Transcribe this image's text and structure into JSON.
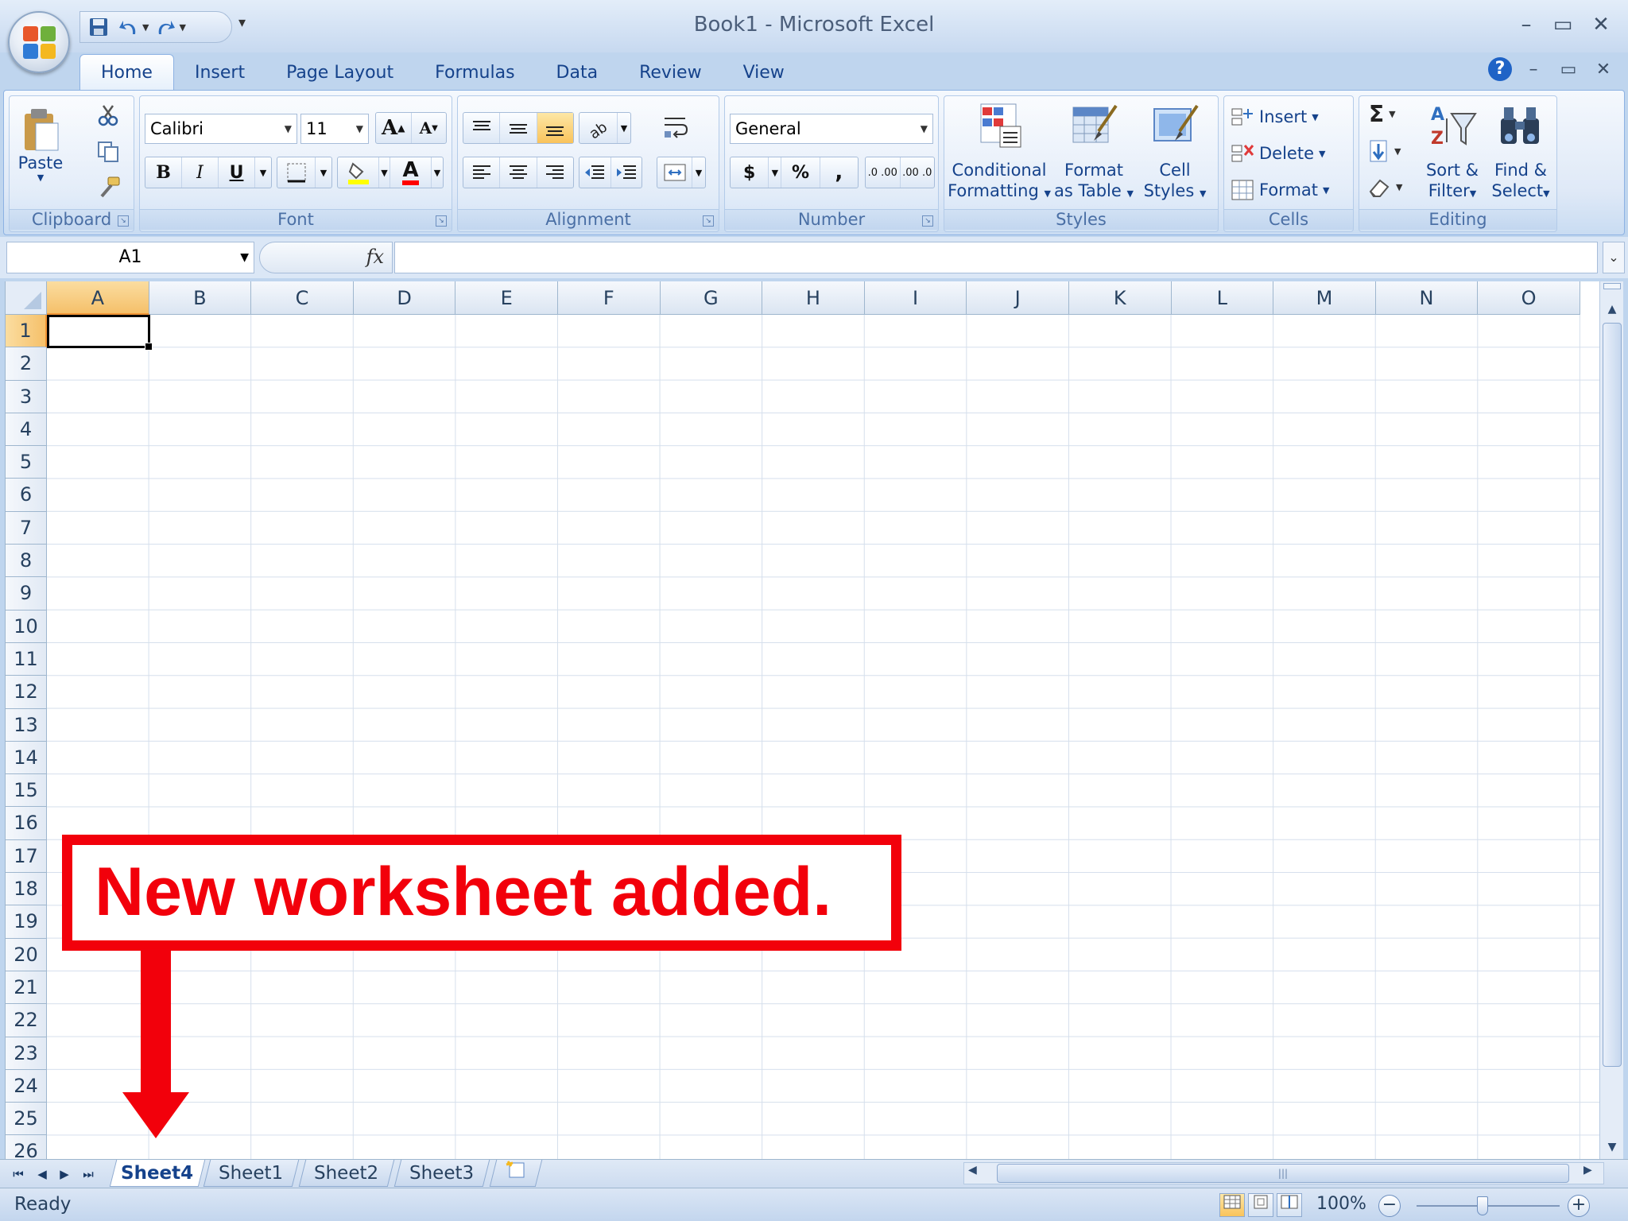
{
  "window": {
    "title": "Book1 - Microsoft Excel",
    "controls": {
      "minimize": "–",
      "restore": "▭",
      "close": "✕"
    }
  },
  "quick_access": {
    "customize": "▾"
  },
  "tabs": [
    "Home",
    "Insert",
    "Page Layout",
    "Formulas",
    "Data",
    "Review",
    "View"
  ],
  "active_tab": "Home",
  "help": "?",
  "ribbon": {
    "clipboard": {
      "label": "Clipboard",
      "paste": "Paste"
    },
    "font": {
      "label": "Font",
      "name": "Calibri",
      "size": "11",
      "bold": "B",
      "italic": "I",
      "underline": "U",
      "grow": "A",
      "shrink": "A",
      "color_letter": "A"
    },
    "alignment": {
      "label": "Alignment"
    },
    "number": {
      "label": "Number",
      "format": "General",
      "currency": "$",
      "percent": "%",
      "comma": ",",
      "inc_decimal": ".0 .00",
      "dec_decimal": ".00 .0"
    },
    "styles": {
      "label": "Styles",
      "conditional": [
        "Conditional",
        "Formatting"
      ],
      "format_table": [
        "Format",
        "as Table"
      ],
      "cell_styles": [
        "Cell",
        "Styles"
      ]
    },
    "cells": {
      "label": "Cells",
      "insert": "Insert",
      "delete": "Delete",
      "format": "Format"
    },
    "editing": {
      "label": "Editing",
      "sigma": "Σ",
      "sort": [
        "Sort &",
        "Filter"
      ],
      "find": [
        "Find &",
        "Select"
      ]
    }
  },
  "formula_bar": {
    "name_box": "A1",
    "fx": "fx",
    "value": ""
  },
  "grid": {
    "columns": [
      "A",
      "B",
      "C",
      "D",
      "E",
      "F",
      "G",
      "H",
      "I",
      "J",
      "K",
      "L",
      "M",
      "N",
      "O"
    ],
    "rows": [
      "1",
      "2",
      "3",
      "4",
      "5",
      "6",
      "7",
      "8",
      "9",
      "10",
      "11",
      "12",
      "13",
      "14",
      "15",
      "16",
      "17",
      "18",
      "19",
      "20",
      "21",
      "22",
      "23",
      "24",
      "25",
      "26"
    ],
    "active_cell": "A1"
  },
  "sheet_tabs": [
    "Sheet4",
    "Sheet1",
    "Sheet2",
    "Sheet3"
  ],
  "active_sheet": "Sheet4",
  "status": {
    "text": "Ready",
    "zoom": "100%"
  },
  "annotation": {
    "text": "New worksheet added."
  },
  "colors": {
    "annotation_red": "#f2000b",
    "selection_orange": "#f5c06a",
    "ribbon_blue": "#15428b"
  }
}
